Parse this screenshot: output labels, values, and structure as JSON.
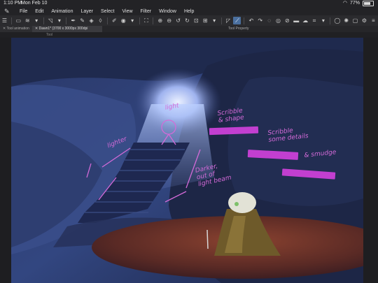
{
  "status_bar": {
    "time": "1:10 PM",
    "date": "Mon Feb 10",
    "battery": "77%"
  },
  "menu": {
    "items": [
      "File",
      "Edit",
      "Animation",
      "Layer",
      "Select",
      "View",
      "Filter",
      "Window",
      "Help"
    ]
  },
  "tabs": {
    "tool_panel": "Tool animation",
    "document": "Dawn1* (3700 x 3000px 300dpi 54.2%)",
    "tool_property": "Tool Property"
  },
  "subtab": {
    "a": "",
    "b": "Tool"
  },
  "notes": {
    "scribble_shape": "Scribble\n& shape",
    "scribble_details": "Scribble\nsome details",
    "smudge": "& smudge",
    "lighter": "lighter",
    "darker": "Darker,\nout of\nlight beam",
    "light": "light"
  },
  "colors": {
    "annotation": "#d46ad8",
    "cave_dark": "#1c2540",
    "cave_mid": "#3c4f86",
    "light_beam": "#c9d8ff",
    "rock_floor": "#6b3329"
  }
}
